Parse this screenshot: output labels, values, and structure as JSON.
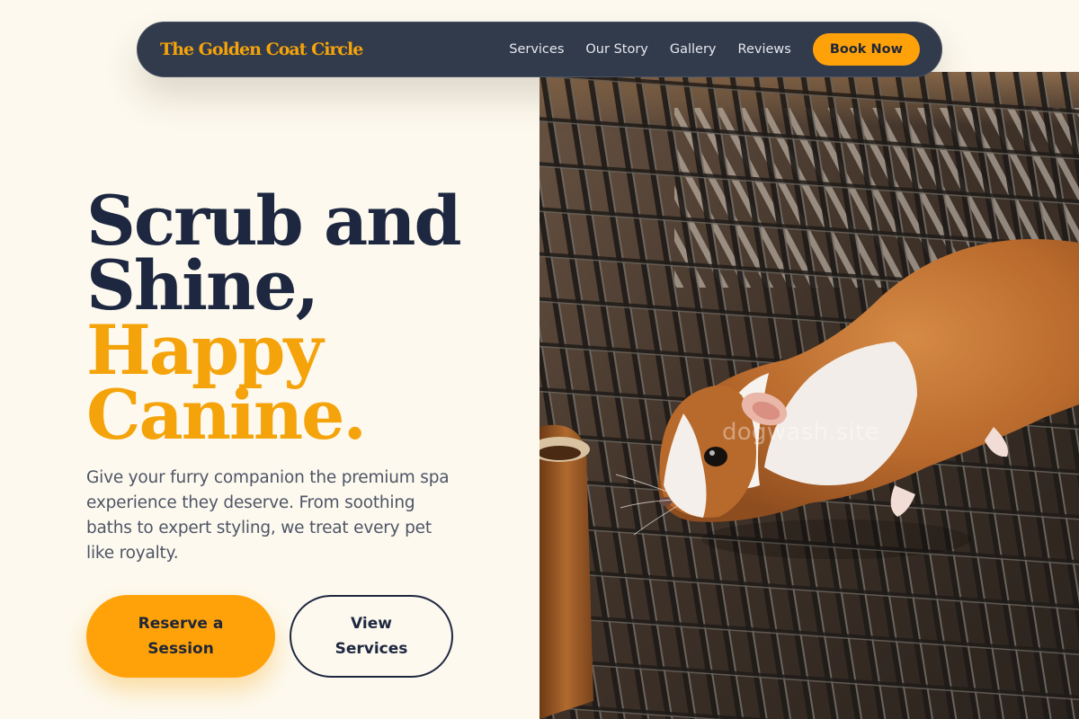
{
  "nav": {
    "brand": "The Golden Coat Circle",
    "links": [
      "Services",
      "Our Story",
      "Gallery",
      "Reviews"
    ],
    "cta": "Book Now"
  },
  "hero": {
    "headline_lines": [
      "Scrub and",
      "Shine,",
      "Happy",
      "Canine."
    ],
    "description": "Give your furry companion the premium spa experience they deserve. From soothing baths to expert styling, we treat every pet like royalty.",
    "primary_button": "Reserve a Session",
    "secondary_button": "View Services"
  },
  "image": {
    "subject": "guinea pig on a wire cage grate",
    "watermark": "dogwash.site"
  },
  "colors": {
    "background": "#fdf9ee",
    "navy": "#1d2740",
    "nav_background": "#323b4c",
    "accent": "#ffa20a",
    "body_text": "#4e5566"
  }
}
